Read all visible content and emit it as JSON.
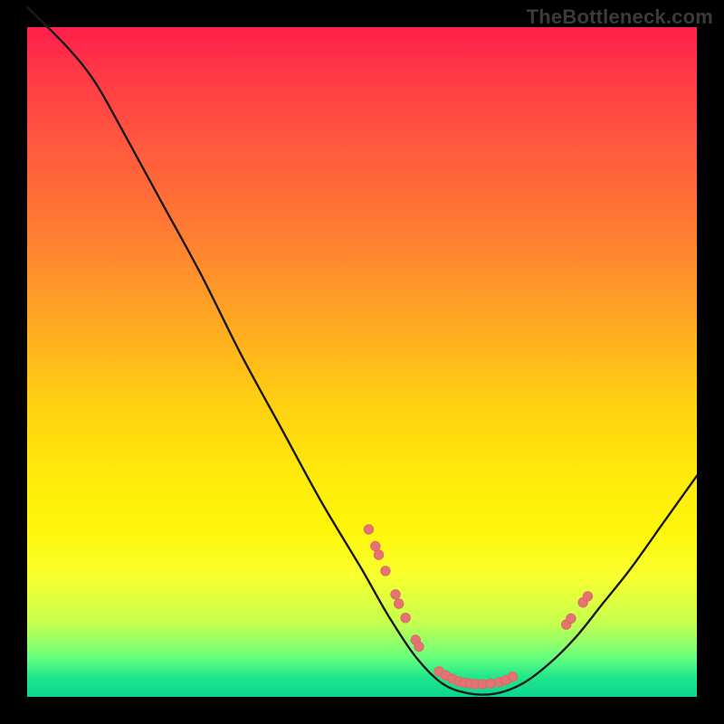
{
  "watermark": "TheBottleneck.com",
  "colors": {
    "curve_stroke": "#1a1a1a",
    "marker_fill": "#e57373",
    "marker_stroke": "#d86a6a"
  },
  "chart_data": {
    "type": "line",
    "title": "",
    "xlabel": "",
    "ylabel": "",
    "xlim": [
      0,
      100
    ],
    "ylim": [
      0,
      100
    ],
    "curve": [
      {
        "x": 0,
        "y": 103
      },
      {
        "x": 6,
        "y": 97
      },
      {
        "x": 10,
        "y": 92
      },
      {
        "x": 14,
        "y": 85
      },
      {
        "x": 20,
        "y": 74
      },
      {
        "x": 26,
        "y": 63
      },
      {
        "x": 32,
        "y": 51
      },
      {
        "x": 38,
        "y": 40
      },
      {
        "x": 44,
        "y": 29
      },
      {
        "x": 50,
        "y": 19
      },
      {
        "x": 54,
        "y": 12
      },
      {
        "x": 58,
        "y": 6
      },
      {
        "x": 62,
        "y": 2
      },
      {
        "x": 66,
        "y": 0.5
      },
      {
        "x": 70,
        "y": 0.5
      },
      {
        "x": 74,
        "y": 2
      },
      {
        "x": 78,
        "y": 5
      },
      {
        "x": 82,
        "y": 9
      },
      {
        "x": 86,
        "y": 14
      },
      {
        "x": 90,
        "y": 19
      },
      {
        "x": 95,
        "y": 26
      },
      {
        "x": 100,
        "y": 33
      }
    ],
    "markers": [
      {
        "x": 51,
        "y": 25
      },
      {
        "x": 52,
        "y": 22.5
      },
      {
        "x": 52.5,
        "y": 21.2
      },
      {
        "x": 53.5,
        "y": 18.8
      },
      {
        "x": 55,
        "y": 15.3
      },
      {
        "x": 55.5,
        "y": 13.9
      },
      {
        "x": 56.5,
        "y": 11.8
      },
      {
        "x": 58,
        "y": 8.5
      },
      {
        "x": 58.5,
        "y": 7.5
      },
      {
        "x": 61.5,
        "y": 3.8
      },
      {
        "x": 62.5,
        "y": 3.2
      },
      {
        "x": 63.5,
        "y": 2.7
      },
      {
        "x": 64.5,
        "y": 2.3
      },
      {
        "x": 65.3,
        "y": 2.1
      },
      {
        "x": 66.2,
        "y": 2.0
      },
      {
        "x": 67.0,
        "y": 1.9
      },
      {
        "x": 68.0,
        "y": 1.9
      },
      {
        "x": 69.2,
        "y": 2.0
      },
      {
        "x": 70.5,
        "y": 2.2
      },
      {
        "x": 71.5,
        "y": 2.5
      },
      {
        "x": 72.5,
        "y": 3.0
      },
      {
        "x": 80.5,
        "y": 10.8
      },
      {
        "x": 81.2,
        "y": 11.7
      },
      {
        "x": 83.0,
        "y": 14.1
      },
      {
        "x": 83.7,
        "y": 15.0
      }
    ]
  }
}
